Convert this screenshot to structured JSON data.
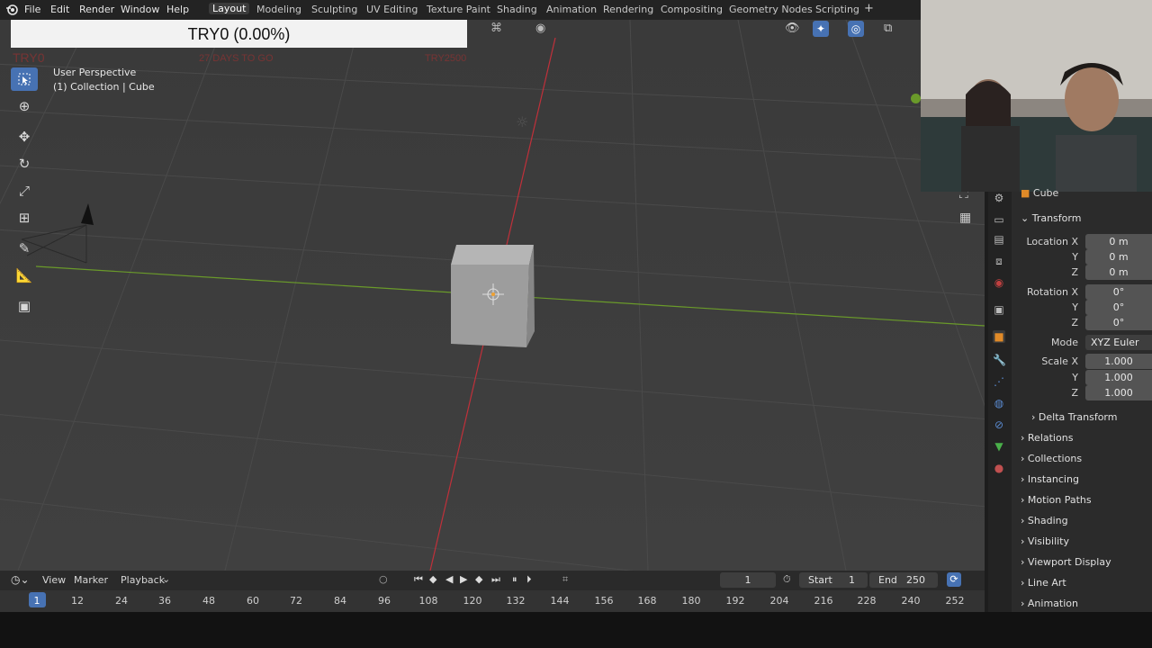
{
  "menu": [
    "File",
    "Edit",
    "Render",
    "Window",
    "Help"
  ],
  "workspaces": [
    "Layout",
    "Modeling",
    "Sculpting",
    "UV Editing",
    "Texture Paint",
    "Shading",
    "Animation",
    "Rendering",
    "Compositing",
    "Geometry Nodes",
    "Scripting"
  ],
  "active_workspace": "Layout",
  "add_tab": "+",
  "overlay": {
    "banner": "TRY0 (0.00%)",
    "corner_small": "TRY0",
    "days_to_go": "27 DAYS TO GO",
    "try_total": "TRY2500"
  },
  "viewport": {
    "perspective": "User Perspective",
    "collection": "(1) Collection | Cube"
  },
  "properties": {
    "object_name": "Cube",
    "transform_label": "Transform",
    "location_label": "Location X",
    "location": [
      "0 m",
      "0 m",
      "0 m"
    ],
    "rotation_label": "Rotation X",
    "rotation": [
      "0°",
      "0°",
      "0°"
    ],
    "axis_y": "Y",
    "axis_z": "Z",
    "mode_label": "Mode",
    "mode_value": "XYZ Euler",
    "scale_label": "Scale X",
    "scale": [
      "1.000",
      "1.000",
      "1.000"
    ],
    "sections": [
      "Delta Transform",
      "Relations",
      "Collections",
      "Instancing",
      "Motion Paths",
      "Shading",
      "Visibility",
      "Viewport Display",
      "Line Art",
      "Animation"
    ]
  },
  "timeline": {
    "view": "View",
    "marker": "Marker",
    "playback": "Playback",
    "current_frame": "1",
    "start_label": "Start",
    "start_value": "1",
    "end_label": "End",
    "end_value": "250",
    "ticks": [
      "1",
      "12",
      "24",
      "36",
      "48",
      "60",
      "72",
      "84",
      "96",
      "108",
      "120",
      "132",
      "144",
      "156",
      "168",
      "180",
      "192",
      "204",
      "216",
      "228",
      "240",
      "252"
    ]
  },
  "colors": {
    "accent": "#4772b3",
    "x_axis": "#c0303a",
    "y_axis": "#6a9a2a"
  }
}
